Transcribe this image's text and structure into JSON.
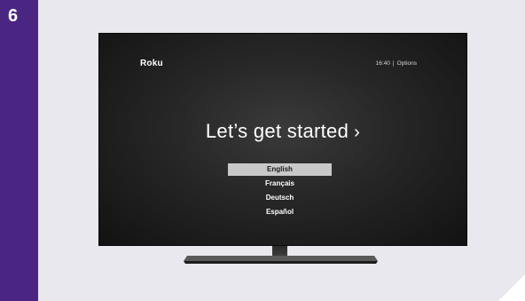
{
  "step": {
    "number": "6"
  },
  "tv": {
    "logo": "Roku",
    "status": {
      "time": "16:40",
      "separator": "|",
      "options": "Options"
    },
    "headline": "Let’s get started",
    "headline_chevron": "›",
    "languages": [
      {
        "label": "English",
        "selected": true
      },
      {
        "label": "Français",
        "selected": false
      },
      {
        "label": "Deutsch",
        "selected": false
      },
      {
        "label": "Español",
        "selected": false
      }
    ]
  },
  "colors": {
    "accent": "#4b2582",
    "card_background": "#e9e8ee",
    "selected_highlight": "#c8c8c8"
  }
}
